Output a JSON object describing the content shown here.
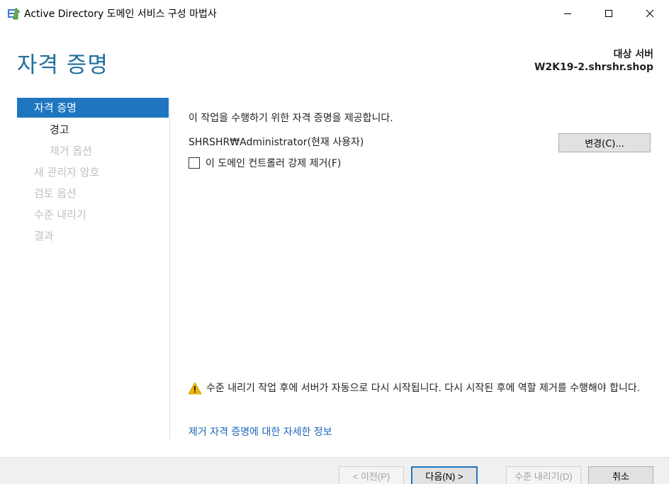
{
  "window": {
    "title": "Active Directory 도메인 서비스 구성 마법사"
  },
  "header": {
    "page_title": "자격 증명",
    "target_label": "대상 서버",
    "target_value": "W2K19-2.shrshr.shop"
  },
  "sidebar": {
    "items": [
      {
        "label": "자격 증명",
        "state": "active"
      },
      {
        "label": "경고",
        "state": "enabled"
      },
      {
        "label": "제거 옵션",
        "state": "disabled"
      },
      {
        "label": "새 관리자 암호",
        "state": "disabled"
      },
      {
        "label": "검토 옵션",
        "state": "disabled"
      },
      {
        "label": "수준 내리기",
        "state": "disabled"
      },
      {
        "label": "결과",
        "state": "disabled"
      }
    ]
  },
  "main": {
    "intro": "이 작업을 수행하기 위한 자격 증명을 제공합니다.",
    "account": "SHRSHR₩Administrator(현재 사용자)",
    "change_button": "변경(C)...",
    "force_remove_label": "이 도메인 컨트롤러 강제 제거(F)",
    "force_remove_checked": false,
    "warning": "수준 내리기 작업 후에 서버가 자동으로 다시 시작됩니다. 다시 시작된 후에 역할 제거를 수행해야 합니다.",
    "more_info_link": "제거 자격 증명에 대한 자세한 정보"
  },
  "footer": {
    "prev": "< 이전(P)",
    "next": "다음(N) >",
    "demote": "수준 내리기(D)",
    "cancel": "취소"
  },
  "colors": {
    "accent": "#1e76c0",
    "title": "#1f6f9e",
    "link": "#1c65b8",
    "warning": "#f2b600"
  }
}
